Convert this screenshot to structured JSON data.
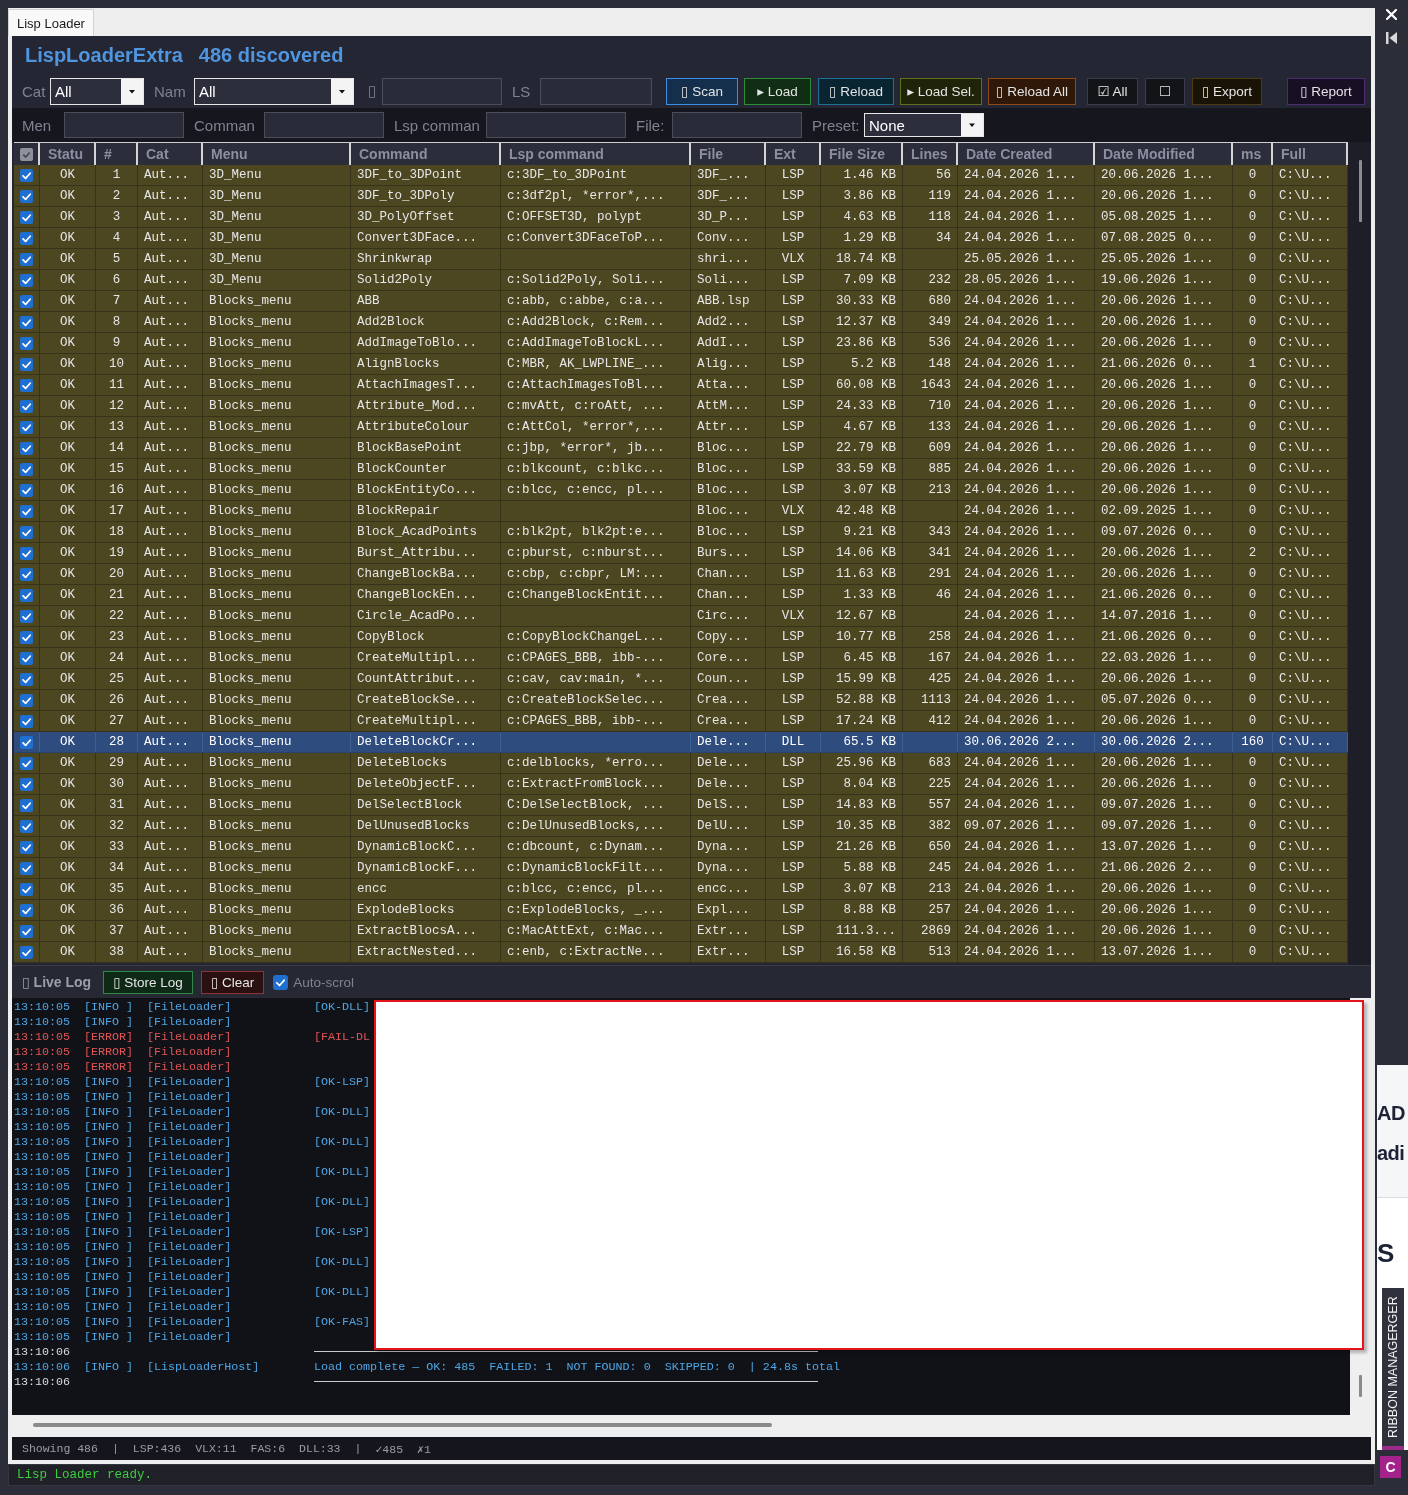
{
  "window": {
    "tabs": [
      {
        "label": "Lisp Loader",
        "selected": true
      }
    ]
  },
  "header": {
    "app_name": "LispLoaderExtra",
    "count": "486 discovered"
  },
  "toolbar": {
    "fields": [
      {
        "kind": "combo",
        "label": "Cat",
        "value": "All"
      },
      {
        "kind": "combo",
        "label": "Nam",
        "value": "All"
      },
      {
        "kind": "text",
        "label": "▯"
      },
      {
        "kind": "text",
        "label": "LS"
      }
    ],
    "buttons": [
      {
        "label": "▯ Scan",
        "color": "#3a8ee6"
      },
      {
        "label": "▸ Load",
        "color": "#2e8b3a"
      },
      {
        "label": "▯ Reload",
        "color": "#1d6f96"
      },
      {
        "label": "▸ Load Sel.",
        "color": "#5d6e1c"
      },
      {
        "label": "▯ Reload All",
        "color": "#8e4a17"
      },
      {
        "label": "☑ All",
        "color": "#3b3d4a"
      },
      {
        "label": "☐",
        "color": "#3b3d4a"
      },
      {
        "label": "▯ Export",
        "color": "#4d3b12"
      },
      {
        "label": "▯ Report",
        "color": "#4b2d70"
      }
    ]
  },
  "filter_bar": {
    "fields": [
      {
        "kind": "text",
        "label": "Men"
      },
      {
        "kind": "text",
        "label": "Comman"
      },
      {
        "kind": "text",
        "label": "Lsp comman"
      },
      {
        "kind": "text",
        "label": "File:"
      },
      {
        "kind": "combo",
        "label": "Preset:",
        "value": "None"
      }
    ]
  },
  "table": {
    "columns": [
      {
        "kind": "check",
        "checked": true
      },
      {
        "kind": "text",
        "label": "Statu"
      },
      {
        "kind": "text",
        "label": "#"
      },
      {
        "kind": "text",
        "label": "Cat"
      },
      {
        "kind": "text",
        "label": "Menu"
      },
      {
        "kind": "text",
        "label": "Command"
      },
      {
        "kind": "text",
        "label": "Lsp command"
      },
      {
        "kind": "text",
        "label": "File"
      },
      {
        "kind": "text",
        "label": "Ext"
      },
      {
        "kind": "text",
        "label": "File Size"
      },
      {
        "kind": "text",
        "label": "Lines"
      },
      {
        "kind": "text",
        "label": "Date Created"
      },
      {
        "kind": "text",
        "label": "Date Modified"
      },
      {
        "kind": "text",
        "label": "ms"
      },
      {
        "kind": "text",
        "label": "Full"
      }
    ],
    "rows": [
      {
        "checked": true,
        "selected": false,
        "status": "OK",
        "number": "1",
        "cat": "Aut...",
        "menu": "3D_Menu",
        "command": "3DF_to_3DPoint",
        "lsp_command": "c:3DF_to_3DPoint",
        "file": "3DF_...",
        "ext": "LSP",
        "file_size": "1.46 KB",
        "lines": "56",
        "date_created": "24.04.2026 1...",
        "date_modified": "20.06.2026 1...",
        "ms": "0",
        "full": "C:\\U..."
      },
      {
        "checked": true,
        "selected": false,
        "status": "OK",
        "number": "2",
        "cat": "Aut...",
        "menu": "3D_Menu",
        "command": "3DF_to_3DPoly",
        "lsp_command": "c:3df2pl, *error*,...",
        "file": "3DF_...",
        "ext": "LSP",
        "file_size": "3.86 KB",
        "lines": "119",
        "date_created": "24.04.2026 1...",
        "date_modified": "20.06.2026 1...",
        "ms": "0",
        "full": "C:\\U..."
      },
      {
        "checked": true,
        "selected": false,
        "status": "OK",
        "number": "3",
        "cat": "Aut...",
        "menu": "3D_Menu",
        "command": "3D_PolyOffset",
        "lsp_command": "C:OFFSET3D, polypt",
        "file": "3D_P...",
        "ext": "LSP",
        "file_size": "4.63 KB",
        "lines": "118",
        "date_created": "24.04.2026 1...",
        "date_modified": "05.08.2025 1...",
        "ms": "0",
        "full": "C:\\U..."
      },
      {
        "checked": true,
        "selected": false,
        "status": "OK",
        "number": "4",
        "cat": "Aut...",
        "menu": "3D_Menu",
        "command": "Convert3DFace...",
        "lsp_command": "c:Convert3DFaceToP...",
        "file": "Conv...",
        "ext": "LSP",
        "file_size": "1.29 KB",
        "lines": "34",
        "date_created": "24.04.2026 1...",
        "date_modified": "07.08.2025 0...",
        "ms": "0",
        "full": "C:\\U..."
      },
      {
        "checked": true,
        "selected": false,
        "status": "OK",
        "number": "5",
        "cat": "Aut...",
        "menu": "3D_Menu",
        "command": "Shrinkwrap",
        "file": "shri...",
        "ext": "VLX",
        "file_size": "18.74 KB",
        "date_created": "25.05.2026 1...",
        "date_modified": "25.05.2026 1...",
        "ms": "0",
        "full": "C:\\U..."
      },
      {
        "checked": true,
        "selected": false,
        "status": "OK",
        "number": "6",
        "cat": "Aut...",
        "menu": "3D_Menu",
        "command": "Solid2Poly",
        "lsp_command": "c:Solid2Poly, Soli...",
        "file": "Soli...",
        "ext": "LSP",
        "file_size": "7.09 KB",
        "lines": "232",
        "date_created": "28.05.2026 1...",
        "date_modified": "19.06.2026 1...",
        "ms": "0",
        "full": "C:\\U..."
      },
      {
        "checked": true,
        "selected": false,
        "status": "OK",
        "number": "7",
        "cat": "Aut...",
        "menu": "Blocks_menu",
        "command": "ABB",
        "lsp_command": "c:abb, c:abbe, c:a...",
        "file": "ABB.lsp",
        "ext": "LSP",
        "file_size": "30.33 KB",
        "lines": "680",
        "date_created": "24.04.2026 1...",
        "date_modified": "20.06.2026 1...",
        "ms": "0",
        "full": "C:\\U..."
      },
      {
        "checked": true,
        "selected": false,
        "status": "OK",
        "number": "8",
        "cat": "Aut...",
        "menu": "Blocks_menu",
        "command": "Add2Block",
        "lsp_command": "c:Add2Block, c:Rem...",
        "file": "Add2...",
        "ext": "LSP",
        "file_size": "12.37 KB",
        "lines": "349",
        "date_created": "24.04.2026 1...",
        "date_modified": "20.06.2026 1...",
        "ms": "0",
        "full": "C:\\U..."
      },
      {
        "checked": true,
        "selected": false,
        "status": "OK",
        "number": "9",
        "cat": "Aut...",
        "menu": "Blocks_menu",
        "command": "AddImageToBlo...",
        "lsp_command": "c:AddImageToBlockL...",
        "file": "AddI...",
        "ext": "LSP",
        "file_size": "23.86 KB",
        "lines": "536",
        "date_created": "24.04.2026 1...",
        "date_modified": "20.06.2026 1...",
        "ms": "0",
        "full": "C:\\U..."
      },
      {
        "checked": true,
        "selected": false,
        "status": "OK",
        "number": "10",
        "cat": "Aut...",
        "menu": "Blocks_menu",
        "command": "AlignBlocks",
        "lsp_command": "C:MBR, AK_LWPLINE_...",
        "file": "Alig...",
        "ext": "LSP",
        "file_size": "5.2 KB",
        "lines": "148",
        "date_created": "24.04.2026 1...",
        "date_modified": "21.06.2026 0...",
        "ms": "1",
        "full": "C:\\U..."
      },
      {
        "checked": true,
        "selected": false,
        "status": "OK",
        "number": "11",
        "cat": "Aut...",
        "menu": "Blocks_menu",
        "command": "AttachImagesT...",
        "lsp_command": "c:AttachImagesToBl...",
        "file": "Atta...",
        "ext": "LSP",
        "file_size": "60.08 KB",
        "lines": "1643",
        "date_created": "24.04.2026 1...",
        "date_modified": "20.06.2026 1...",
        "ms": "0",
        "full": "C:\\U..."
      },
      {
        "checked": true,
        "selected": false,
        "status": "OK",
        "number": "12",
        "cat": "Aut...",
        "menu": "Blocks_menu",
        "command": "Attribute_Mod...",
        "lsp_command": "c:mvAtt, c:roAtt, ...",
        "file": "AttM...",
        "ext": "LSP",
        "file_size": "24.33 KB",
        "lines": "710",
        "date_created": "24.04.2026 1...",
        "date_modified": "20.06.2026 1...",
        "ms": "0",
        "full": "C:\\U..."
      },
      {
        "checked": true,
        "selected": false,
        "status": "OK",
        "number": "13",
        "cat": "Aut...",
        "menu": "Blocks_menu",
        "command": "AttributeColour",
        "lsp_command": "c:AttCol, *error*,...",
        "file": "Attr...",
        "ext": "LSP",
        "file_size": "4.67 KB",
        "lines": "133",
        "date_created": "24.04.2026 1...",
        "date_modified": "20.06.2026 1...",
        "ms": "0",
        "full": "C:\\U..."
      },
      {
        "checked": true,
        "selected": false,
        "status": "OK",
        "number": "14",
        "cat": "Aut...",
        "menu": "Blocks_menu",
        "command": "BlockBasePoint",
        "lsp_command": "c:jbp, *error*, jb...",
        "file": "Bloc...",
        "ext": "LSP",
        "file_size": "22.79 KB",
        "lines": "609",
        "date_created": "24.04.2026 1...",
        "date_modified": "20.06.2026 1...",
        "ms": "0",
        "full": "C:\\U..."
      },
      {
        "checked": true,
        "selected": false,
        "status": "OK",
        "number": "15",
        "cat": "Aut...",
        "menu": "Blocks_menu",
        "command": "BlockCounter",
        "lsp_command": "c:blkcount, c:blkc...",
        "file": "Bloc...",
        "ext": "LSP",
        "file_size": "33.59 KB",
        "lines": "885",
        "date_created": "24.04.2026 1...",
        "date_modified": "20.06.2026 1...",
        "ms": "0",
        "full": "C:\\U..."
      },
      {
        "checked": true,
        "selected": false,
        "status": "OK",
        "number": "16",
        "cat": "Aut...",
        "menu": "Blocks_menu",
        "command": "BlockEntityCo...",
        "lsp_command": "c:blcc, c:encc, pl...",
        "file": "Bloc...",
        "ext": "LSP",
        "file_size": "3.07 KB",
        "lines": "213",
        "date_created": "24.04.2026 1...",
        "date_modified": "20.06.2026 1...",
        "ms": "0",
        "full": "C:\\U..."
      },
      {
        "checked": true,
        "selected": false,
        "status": "OK",
        "number": "17",
        "cat": "Aut...",
        "menu": "Blocks_menu",
        "command": "BlockRepair",
        "file": "Bloc...",
        "ext": "VLX",
        "file_size": "42.48 KB",
        "date_created": "24.04.2026 1...",
        "date_modified": "02.09.2025 1...",
        "ms": "0",
        "full": "C:\\U..."
      },
      {
        "checked": true,
        "selected": false,
        "status": "OK",
        "number": "18",
        "cat": "Aut...",
        "menu": "Blocks_menu",
        "command": "Block_AcadPoints",
        "lsp_command": "c:blk2pt, blk2pt:e...",
        "file": "Bloc...",
        "ext": "LSP",
        "file_size": "9.21 KB",
        "lines": "343",
        "date_created": "24.04.2026 1...",
        "date_modified": "09.07.2026 0...",
        "ms": "0",
        "full": "C:\\U..."
      },
      {
        "checked": true,
        "selected": false,
        "status": "OK",
        "number": "19",
        "cat": "Aut...",
        "menu": "Blocks_menu",
        "command": "Burst_Attribu...",
        "lsp_command": "c:pburst, c:nburst...",
        "file": "Burs...",
        "ext": "LSP",
        "file_size": "14.06 KB",
        "lines": "341",
        "date_created": "24.04.2026 1...",
        "date_modified": "20.06.2026 1...",
        "ms": "2",
        "full": "C:\\U..."
      },
      {
        "checked": true,
        "selected": false,
        "status": "OK",
        "number": "20",
        "cat": "Aut...",
        "menu": "Blocks_menu",
        "command": "ChangeBlockBa...",
        "lsp_command": "c:cbp, c:cbpr, LM:...",
        "file": "Chan...",
        "ext": "LSP",
        "file_size": "11.63 KB",
        "lines": "291",
        "date_created": "24.04.2026 1...",
        "date_modified": "20.06.2026 1...",
        "ms": "0",
        "full": "C:\\U..."
      },
      {
        "checked": true,
        "selected": false,
        "status": "OK",
        "number": "21",
        "cat": "Aut...",
        "menu": "Blocks_menu",
        "command": "ChangeBlockEn...",
        "lsp_command": "c:ChangeBlockEntit...",
        "file": "Chan...",
        "ext": "LSP",
        "file_size": "1.33 KB",
        "lines": "46",
        "date_created": "24.04.2026 1...",
        "date_modified": "21.06.2026 0...",
        "ms": "0",
        "full": "C:\\U..."
      },
      {
        "checked": true,
        "selected": false,
        "status": "OK",
        "number": "22",
        "cat": "Aut...",
        "menu": "Blocks_menu",
        "command": "Circle_AcadPo...",
        "file": "Circ...",
        "ext": "VLX",
        "file_size": "12.67 KB",
        "date_created": "24.04.2026 1...",
        "date_modified": "14.07.2016 1...",
        "ms": "0",
        "full": "C:\\U..."
      },
      {
        "checked": true,
        "selected": false,
        "status": "OK",
        "number": "23",
        "cat": "Aut...",
        "menu": "Blocks_menu",
        "command": "CopyBlock",
        "lsp_command": "c:CopyBlockChangeL...",
        "file": "Copy...",
        "ext": "LSP",
        "file_size": "10.77 KB",
        "lines": "258",
        "date_created": "24.04.2026 1...",
        "date_modified": "21.06.2026 0...",
        "ms": "0",
        "full": "C:\\U..."
      },
      {
        "checked": true,
        "selected": false,
        "status": "OK",
        "number": "24",
        "cat": "Aut...",
        "menu": "Blocks_menu",
        "command": "CreateMultipl...",
        "lsp_command": "c:CPAGES_BBB, ibb-...",
        "file": "Core...",
        "ext": "LSP",
        "file_size": "6.45 KB",
        "lines": "167",
        "date_created": "24.04.2026 1...",
        "date_modified": "22.03.2026 1...",
        "ms": "0",
        "full": "C:\\U..."
      },
      {
        "checked": true,
        "selected": false,
        "status": "OK",
        "number": "25",
        "cat": "Aut...",
        "menu": "Blocks_menu",
        "command": "CountAttribut...",
        "lsp_command": "c:cav, cav:main, *...",
        "file": "Coun...",
        "ext": "LSP",
        "file_size": "15.99 KB",
        "lines": "425",
        "date_created": "24.04.2026 1...",
        "date_modified": "20.06.2026 1...",
        "ms": "0",
        "full": "C:\\U..."
      },
      {
        "checked": true,
        "selected": false,
        "status": "OK",
        "number": "26",
        "cat": "Aut...",
        "menu": "Blocks_menu",
        "command": "CreateBlockSe...",
        "lsp_command": "c:CreateBlockSelec...",
        "file": "Crea...",
        "ext": "LSP",
        "file_size": "52.88 KB",
        "lines": "1113",
        "date_created": "24.04.2026 1...",
        "date_modified": "05.07.2026 0...",
        "ms": "0",
        "full": "C:\\U..."
      },
      {
        "checked": true,
        "selected": false,
        "status": "OK",
        "number": "27",
        "cat": "Aut...",
        "menu": "Blocks_menu",
        "command": "CreateMultipl...",
        "lsp_command": "c:CPAGES_BBB, ibb-...",
        "file": "Crea...",
        "ext": "LSP",
        "file_size": "17.24 KB",
        "lines": "412",
        "date_created": "24.04.2026 1...",
        "date_modified": "20.06.2026 1...",
        "ms": "0",
        "full": "C:\\U..."
      },
      {
        "checked": true,
        "selected": true,
        "status": "OK",
        "number": "28",
        "cat": "Aut...",
        "menu": "Blocks_menu",
        "command": "DeleteBlockCr...",
        "file": "Dele...",
        "ext": "DLL",
        "file_size": "65.5 KB",
        "date_created": "30.06.2026 2...",
        "date_modified": "30.06.2026 2...",
        "ms": "160",
        "full": "C:\\U..."
      },
      {
        "checked": true,
        "selected": false,
        "status": "OK",
        "number": "29",
        "cat": "Aut...",
        "menu": "Blocks_menu",
        "command": "DeleteBlocks",
        "lsp_command": "c:delblocks, *erro...",
        "file": "Dele...",
        "ext": "LSP",
        "file_size": "25.96 KB",
        "lines": "683",
        "date_created": "24.04.2026 1...",
        "date_modified": "20.06.2026 1...",
        "ms": "0",
        "full": "C:\\U..."
      },
      {
        "checked": true,
        "selected": false,
        "status": "OK",
        "number": "30",
        "cat": "Aut...",
        "menu": "Blocks_menu",
        "command": "DeleteObjectF...",
        "lsp_command": "c:ExtractFromBlock...",
        "file": "Dele...",
        "ext": "LSP",
        "file_size": "8.04 KB",
        "lines": "225",
        "date_created": "24.04.2026 1...",
        "date_modified": "20.06.2026 1...",
        "ms": "0",
        "full": "C:\\U..."
      },
      {
        "checked": true,
        "selected": false,
        "status": "OK",
        "number": "31",
        "cat": "Aut...",
        "menu": "Blocks_menu",
        "command": "DelSelectBlock",
        "lsp_command": "C:DelSelectBlock, ...",
        "file": "DelS...",
        "ext": "LSP",
        "file_size": "14.83 KB",
        "lines": "557",
        "date_created": "24.04.2026 1...",
        "date_modified": "09.07.2026 1...",
        "ms": "0",
        "full": "C:\\U..."
      },
      {
        "checked": true,
        "selected": false,
        "status": "OK",
        "number": "32",
        "cat": "Aut...",
        "menu": "Blocks_menu",
        "command": "DelUnusedBlocks",
        "lsp_command": "c:DelUnusedBlocks,...",
        "file": "DelU...",
        "ext": "LSP",
        "file_size": "10.35 KB",
        "lines": "382",
        "date_created": "09.07.2026 1...",
        "date_modified": "09.07.2026 1...",
        "ms": "0",
        "full": "C:\\U..."
      },
      {
        "checked": true,
        "selected": false,
        "status": "OK",
        "number": "33",
        "cat": "Aut...",
        "menu": "Blocks_menu",
        "command": "DynamicBlockC...",
        "lsp_command": "c:dbcount, c:Dynam...",
        "file": "Dyna...",
        "ext": "LSP",
        "file_size": "21.26 KB",
        "lines": "650",
        "date_created": "24.04.2026 1...",
        "date_modified": "13.07.2026 1...",
        "ms": "0",
        "full": "C:\\U..."
      },
      {
        "checked": true,
        "selected": false,
        "status": "OK",
        "number": "34",
        "cat": "Aut...",
        "menu": "Blocks_menu",
        "command": "DynamicBlockF...",
        "lsp_command": "c:DynamicBlockFilt...",
        "file": "Dyna...",
        "ext": "LSP",
        "file_size": "5.88 KB",
        "lines": "245",
        "date_created": "24.04.2026 1...",
        "date_modified": "21.06.2026 2...",
        "ms": "0",
        "full": "C:\\U..."
      },
      {
        "checked": true,
        "selected": false,
        "status": "OK",
        "number": "35",
        "cat": "Aut...",
        "menu": "Blocks_menu",
        "command": "encc",
        "lsp_command": "c:blcc, c:encc, pl...",
        "file": "encc...",
        "ext": "LSP",
        "file_size": "3.07 KB",
        "lines": "213",
        "date_created": "24.04.2026 1...",
        "date_modified": "20.06.2026 1...",
        "ms": "0",
        "full": "C:\\U..."
      },
      {
        "checked": true,
        "selected": false,
        "status": "OK",
        "number": "36",
        "cat": "Aut...",
        "menu": "Blocks_menu",
        "command": "ExplodeBlocks",
        "lsp_command": "c:ExplodeBlocks, _...",
        "file": "Expl...",
        "ext": "LSP",
        "file_size": "8.88 KB",
        "lines": "257",
        "date_created": "24.04.2026 1...",
        "date_modified": "20.06.2026 1...",
        "ms": "0",
        "full": "C:\\U..."
      },
      {
        "checked": true,
        "selected": false,
        "status": "OK",
        "number": "37",
        "cat": "Aut...",
        "menu": "Blocks_menu",
        "command": "ExtractBlocsA...",
        "lsp_command": "c:MacAttExt, c:Mac...",
        "file": "Extr...",
        "ext": "LSP",
        "file_size": "111.3...",
        "lines": "2869",
        "date_created": "24.04.2026 1...",
        "date_modified": "20.06.2026 1...",
        "ms": "0",
        "full": "C:\\U..."
      },
      {
        "checked": true,
        "selected": false,
        "status": "OK",
        "number": "38",
        "cat": "Aut...",
        "menu": "Blocks_menu",
        "command": "ExtractNested...",
        "lsp_command": "c:enb, c:ExtractNe...",
        "file": "Extr...",
        "ext": "LSP",
        "file_size": "16.58 KB",
        "lines": "513",
        "date_created": "24.04.2026 1...",
        "date_modified": "13.07.2026 1...",
        "ms": "0",
        "full": "C:\\U..."
      }
    ]
  },
  "log": {
    "title": "▯ Live Log",
    "buttons": [
      {
        "label": "▯ Store Log",
        "color": "#2f8a45"
      },
      {
        "label": "▯ Clear",
        "color": "#8b3535"
      }
    ],
    "auto_scroll": {
      "label": "Auto-scrol",
      "checked": true
    },
    "blank_overlay": true,
    "lines": [
      {
        "kind": "info",
        "time": "13:10:05",
        "tag": "[INFO ]",
        "source": "[FileLoader]",
        "message": "[OK-DLL]"
      },
      {
        "kind": "info",
        "time": "13:10:05",
        "tag": "[INFO ]",
        "source": "[FileLoader]"
      },
      {
        "kind": "error",
        "time": "13:10:05",
        "tag": "[ERROR]",
        "source": "[FileLoader]",
        "message": "[FAIL-DL"
      },
      {
        "kind": "error",
        "time": "13:10:05",
        "tag": "[ERROR]",
        "source": "[FileLoader]"
      },
      {
        "kind": "error",
        "time": "13:10:05",
        "tag": "[ERROR]",
        "source": "[FileLoader]"
      },
      {
        "kind": "info",
        "time": "13:10:05",
        "tag": "[INFO ]",
        "source": "[FileLoader]",
        "message": "[OK-LSP]"
      },
      {
        "kind": "info",
        "time": "13:10:05",
        "tag": "[INFO ]",
        "source": "[FileLoader]"
      },
      {
        "kind": "info",
        "time": "13:10:05",
        "tag": "[INFO ]",
        "source": "[FileLoader]",
        "message": "[OK-DLL]"
      },
      {
        "kind": "info",
        "time": "13:10:05",
        "tag": "[INFO ]",
        "source": "[FileLoader]"
      },
      {
        "kind": "info",
        "time": "13:10:05",
        "tag": "[INFO ]",
        "source": "[FileLoader]",
        "message": "[OK-DLL]"
      },
      {
        "kind": "info",
        "time": "13:10:05",
        "tag": "[INFO ]",
        "source": "[FileLoader]"
      },
      {
        "kind": "info",
        "time": "13:10:05",
        "tag": "[INFO ]",
        "source": "[FileLoader]",
        "message": "[OK-DLL]"
      },
      {
        "kind": "info",
        "time": "13:10:05",
        "tag": "[INFO ]",
        "source": "[FileLoader]"
      },
      {
        "kind": "info",
        "time": "13:10:05",
        "tag": "[INFO ]",
        "source": "[FileLoader]",
        "message": "[OK-DLL]"
      },
      {
        "kind": "info",
        "time": "13:10:05",
        "tag": "[INFO ]",
        "source": "[FileLoader]"
      },
      {
        "kind": "info",
        "time": "13:10:05",
        "tag": "[INFO ]",
        "source": "[FileLoader]",
        "message": "[OK-LSP]"
      },
      {
        "kind": "info",
        "time": "13:10:05",
        "tag": "[INFO ]",
        "source": "[FileLoader]"
      },
      {
        "kind": "info",
        "time": "13:10:05",
        "tag": "[INFO ]",
        "source": "[FileLoader]",
        "message": "[OK-DLL]"
      },
      {
        "kind": "info",
        "time": "13:10:05",
        "tag": "[INFO ]",
        "source": "[FileLoader]"
      },
      {
        "kind": "info",
        "time": "13:10:05",
        "tag": "[INFO ]",
        "source": "[FileLoader]",
        "message": "[OK-DLL]"
      },
      {
        "kind": "info",
        "time": "13:10:05",
        "tag": "[INFO ]",
        "source": "[FileLoader]"
      },
      {
        "kind": "info",
        "time": "13:10:05",
        "tag": "[INFO ]",
        "source": "[FileLoader]",
        "message": "[OK-FAS]"
      },
      {
        "kind": "info",
        "time": "13:10:05",
        "tag": "[INFO ]",
        "source": "[FileLoader]"
      },
      {
        "kind": "rule",
        "time": "13:10:06"
      },
      {
        "kind": "info",
        "time": "13:10:06",
        "tag": "[INFO ]",
        "source": "[LispLoaderHost]",
        "message": "Load complete — OK: 485  FAILED: 1  NOT FOUND: 0  SKIPPED: 0  | 24.8s total"
      },
      {
        "kind": "rule",
        "time": "13:10:06"
      }
    ]
  },
  "status_bar": {
    "items": [
      "Showing 486",
      "|",
      "LSP:436",
      "VLX:11",
      "FAS:6",
      "DLL:33",
      "|",
      "✓485",
      "✗1"
    ]
  },
  "ready_bar": {
    "message": "Lisp Loader ready."
  },
  "side": {
    "background_window": {
      "texts": [
        "AD",
        "adi",
        "S"
      ]
    },
    "palette_tab": {
      "label": "RIBBON MANAGERGER"
    },
    "app_icon": {
      "letter": "C"
    }
  }
}
